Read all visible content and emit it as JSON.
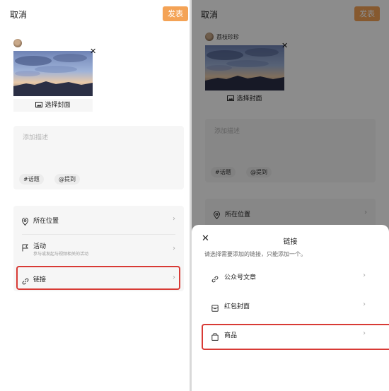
{
  "left": {
    "cancel_label": "取消",
    "publish_label": "发表",
    "select_cover_label": "选择封面",
    "description_placeholder": "添加描述",
    "tags": [
      "#话题",
      "@提到"
    ],
    "menu": {
      "location": {
        "label": "所在位置"
      },
      "activity": {
        "label": "活动",
        "sub": "参与或发起与视频相关的活动"
      },
      "link": {
        "label": "链接"
      }
    }
  },
  "right": {
    "cancel_label": "取消",
    "publish_label": "发表",
    "username": "荔枝珍珍",
    "select_cover_label": "选择封面",
    "description_placeholder": "添加描述",
    "tags": [
      "#话题",
      "@提到"
    ],
    "menu": {
      "location": {
        "label": "所在位置"
      }
    },
    "sheet": {
      "title": "链接",
      "description": "请选择需要添加的链接，只能添加一个。",
      "options": [
        {
          "label": "公众号文章",
          "icon": "link-icon"
        },
        {
          "label": "红包封面",
          "icon": "red-envelope-icon"
        },
        {
          "label": "商品",
          "icon": "shopping-bag-icon"
        }
      ]
    }
  },
  "colors": {
    "accent": "#f4a356",
    "highlight": "#d83a35",
    "surface": "#f6f6f6"
  }
}
